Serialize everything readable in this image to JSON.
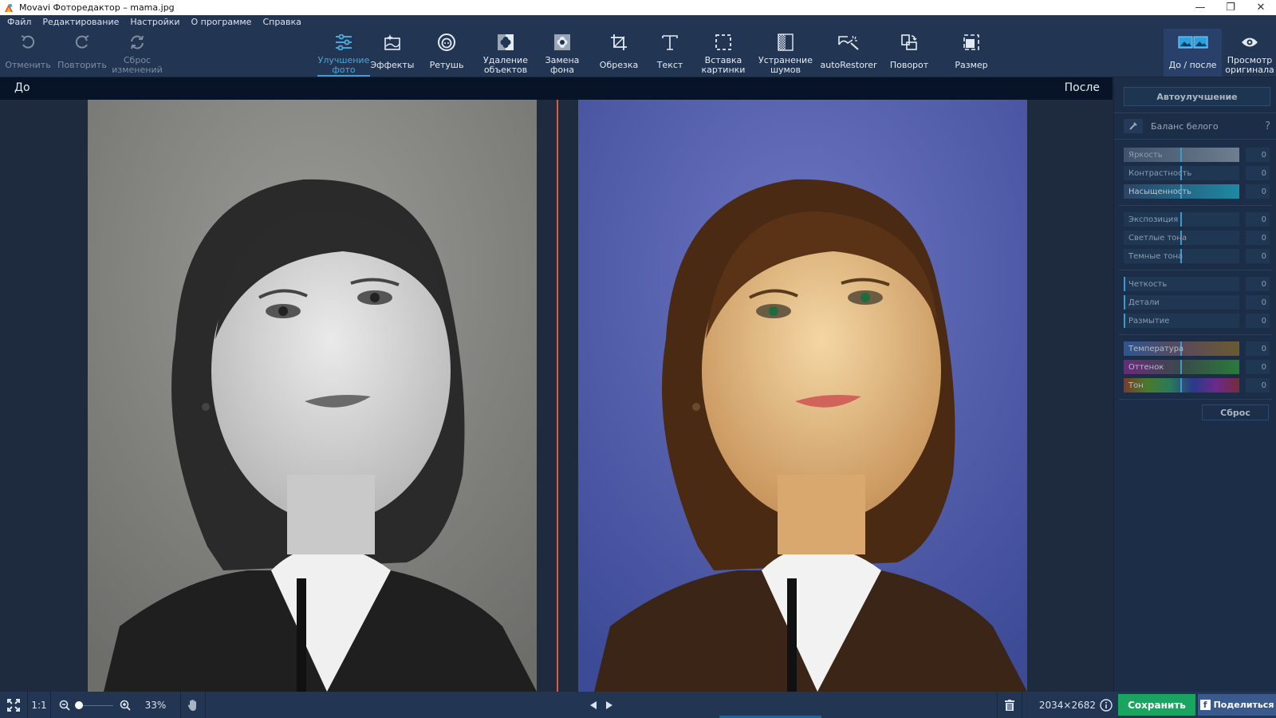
{
  "window": {
    "title": "Movavi Фоторедактор – mama.jpg",
    "minimize": "—",
    "maximize": "❐",
    "close": "✕"
  },
  "menu": [
    "Файл",
    "Редактирование",
    "Настройки",
    "О программе",
    "Справка"
  ],
  "toolbar": {
    "undo": "Отменить",
    "redo": "Повторить",
    "reset_changes": "Сброс\nизменений",
    "tools": [
      {
        "label": "Улучшение\nфото",
        "icon": "sliders-icon",
        "active": true
      },
      {
        "label": "Эффекты",
        "icon": "effects-icon"
      },
      {
        "label": "Ретушь",
        "icon": "retouch-face-icon"
      },
      {
        "label": "Удаление\nобъектов",
        "icon": "object-removal-icon"
      },
      {
        "label": "Замена\nфона",
        "icon": "background-replace-icon"
      },
      {
        "label": "Обрезка",
        "icon": "crop-icon"
      },
      {
        "label": "Текст",
        "icon": "text-icon"
      },
      {
        "label": "Вставка\nкартинки",
        "icon": "insert-image-icon"
      },
      {
        "label": "Устранение\nшумов",
        "icon": "denoise-icon"
      },
      {
        "label": "autoRestorer",
        "icon": "auto-restorer-icon"
      },
      {
        "label": "Поворот",
        "icon": "rotate-icon"
      },
      {
        "label": "Размер",
        "icon": "resize-icon"
      }
    ],
    "before_after": "До / после",
    "view_original": "Просмотр\nоригинала"
  },
  "view": {
    "before_label": "До",
    "after_label": "После",
    "divider_color": "#e25a3a"
  },
  "panel": {
    "auto_enhance": "Автоулучшение",
    "white_balance": "Баланс белого",
    "help": "?",
    "groups": [
      [
        {
          "label": "Яркость",
          "value": "0"
        },
        {
          "label": "Контрастность",
          "value": "0"
        },
        {
          "label": "Насыщенность",
          "value": "0"
        }
      ],
      [
        {
          "label": "Экспозиция",
          "value": "0"
        },
        {
          "label": "Светлые тона",
          "value": "0"
        },
        {
          "label": "Темные тона",
          "value": "0"
        }
      ],
      [
        {
          "label": "Четкость",
          "value": "0"
        },
        {
          "label": "Детали",
          "value": "0"
        },
        {
          "label": "Размытие",
          "value": "0"
        }
      ],
      [
        {
          "label": "Температура",
          "value": "0"
        },
        {
          "label": "Оттенок",
          "value": "0"
        },
        {
          "label": "Тон",
          "value": "0"
        }
      ]
    ],
    "reset": "Сброс"
  },
  "bottom": {
    "fit_label": "1:1",
    "zoom_percent": "33%",
    "zoom_slider_fraction": 0.0,
    "image_size": "2034×2682",
    "save": "Сохранить",
    "share": "Поделиться",
    "fb_glyph": "f"
  },
  "colors": {
    "accent": "#3aa0d8",
    "save": "#19a45f",
    "share": "#3a5a8e",
    "bg": "#223552"
  }
}
